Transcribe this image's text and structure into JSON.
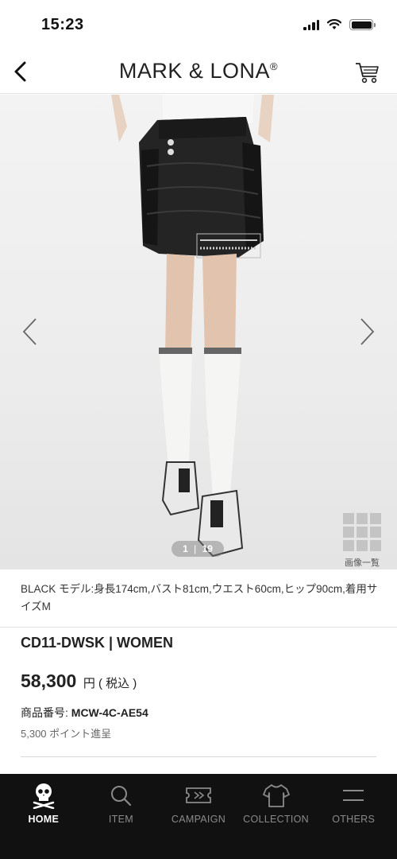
{
  "status_bar": {
    "time": "15:23"
  },
  "header": {
    "brand": "MARK & LONA",
    "brand_mark": "®",
    "back_icon": "chevron-left-icon",
    "cart_icon": "cart-icon"
  },
  "gallery": {
    "current": "1",
    "separator": "|",
    "total": "19",
    "image_list_label": "画像一覧",
    "prev_icon": "chevron-left-icon",
    "next_icon": "chevron-right-icon"
  },
  "product": {
    "model_info": "BLACK モデル:身長174cm,バスト81cm,ウエスト60cm,ヒップ90cm,着用サイズM",
    "name": "CD11-DWSK | WOMEN",
    "price": "58,300",
    "price_suffix": "円 ( 税込 )",
    "code_label": "商品番号:",
    "code_value": "MCW-4C-AE54",
    "points": "5,300 ポイント進呈"
  },
  "bottom_nav": {
    "items": [
      {
        "label": "HOME",
        "icon": "skull-icon",
        "active": true
      },
      {
        "label": "ITEM",
        "icon": "search-icon",
        "active": false
      },
      {
        "label": "CAMPAIGN",
        "icon": "ticket-icon",
        "active": false
      },
      {
        "label": "COLLECTION",
        "icon": "shirt-icon",
        "active": false
      },
      {
        "label": "OTHERS",
        "icon": "menu-icon",
        "active": false
      }
    ]
  },
  "colors": {
    "nav_background": "#111111",
    "nav_active": "#ffffff",
    "nav_inactive": "#8a8a8a"
  }
}
